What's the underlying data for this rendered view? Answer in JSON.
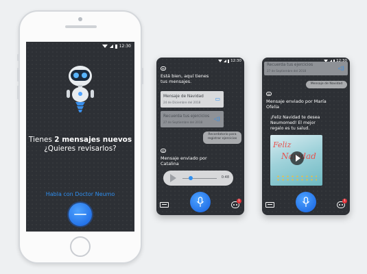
{
  "phone": {
    "time": "12:30",
    "main_line1_prefix": "Tienes ",
    "main_line1_bold": "2 mensajes nuevos",
    "main_line2": "¿Quieres revisarlos?",
    "talk_link": "Habla con Doctor Neumo"
  },
  "screen2": {
    "time": "12:30",
    "intro": "Está bien, aquí tienes tus mensajes.",
    "cards": [
      {
        "title": "Mensaje de Navidad",
        "date": "24 de Diciembre del 2018",
        "icon": "video-icon"
      },
      {
        "title": "Recuerda tus ejercicios",
        "date": "27 de Septiembre del 2018",
        "icon": "audio-icon"
      }
    ],
    "reminder_bubble": "Recordatorio para registrar ejercicios",
    "sent_by": "Mensaje enviado por Catalina",
    "audio_time": "0:48",
    "badge_count": "1"
  },
  "screen3": {
    "time": "12:30",
    "card_title": "Recuerda tus ejercicios",
    "card_date": "27 de Septiembre del 2018",
    "bubble": "Mensaje de Navidad",
    "sent_by": "Mensaje enviado por María Ofelia",
    "message": "¡Feliz Navidad te desea Neumomed! El mejor regalo es tu salud.",
    "video_deco_1": "Feliz",
    "video_deco_2": "Navidad",
    "badge_count": "1"
  },
  "colors": {
    "accent": "#2f8ff0",
    "screen_bg": "#2d3035",
    "badge": "#e2333a"
  }
}
